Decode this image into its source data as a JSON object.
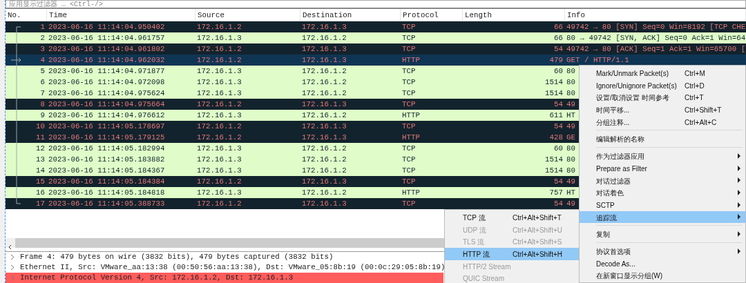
{
  "filter_bar": {
    "placeholder": "应用显示过滤器 … <Ctrl-/>"
  },
  "packet_list": {
    "columns": [
      "No.",
      "Time",
      "Source",
      "Destination",
      "Protocol",
      "Length",
      "Info"
    ],
    "rows": [
      {
        "no": "1",
        "time": "2023-06-16 11:14:04.950402",
        "source": "172.16.1.2",
        "destination": "172.16.1.3",
        "protocol": "TCP",
        "length": "66",
        "info": "49742 → 80 [SYN] Seq=0 Win=8192 [TCP CHE",
        "kind": "dark",
        "selected": false
      },
      {
        "no": "2",
        "time": "2023-06-16 11:14:04.961757",
        "source": "172.16.1.3",
        "destination": "172.16.1.2",
        "protocol": "TCP",
        "length": "66",
        "info": "80 → 49742 [SYN, ACK] Seq=0 Ack=1 Win=64",
        "kind": "light",
        "selected": false
      },
      {
        "no": "3",
        "time": "2023-06-16 11:14:04.961802",
        "source": "172.16.1.2",
        "destination": "172.16.1.3",
        "protocol": "TCP",
        "length": "54",
        "info": "49742 → 80 [ACK] Seq=1 Ack=1 Win=65700 [",
        "kind": "dark",
        "selected": false
      },
      {
        "no": "4",
        "time": "2023-06-16 11:14:04.962032",
        "source": "172.16.1.2",
        "destination": "172.16.1.3",
        "protocol": "HTTP",
        "length": "479",
        "info": "GET / HTTP/1.1",
        "kind": "dark",
        "selected": true
      },
      {
        "no": "5",
        "time": "2023-06-16 11:14:04.971877",
        "source": "172.16.1.3",
        "destination": "172.16.1.2",
        "protocol": "TCP",
        "length": "60",
        "info": "80",
        "kind": "light",
        "selected": false
      },
      {
        "no": "6",
        "time": "2023-06-16 11:14:04.972098",
        "source": "172.16.1.3",
        "destination": "172.16.1.2",
        "protocol": "TCP",
        "length": "1514",
        "info": "80",
        "kind": "light",
        "selected": false
      },
      {
        "no": "7",
        "time": "2023-06-16 11:14:04.975624",
        "source": "172.16.1.3",
        "destination": "172.16.1.2",
        "protocol": "TCP",
        "length": "1514",
        "info": "80",
        "kind": "light",
        "selected": false
      },
      {
        "no": "8",
        "time": "2023-06-16 11:14:04.975664",
        "source": "172.16.1.2",
        "destination": "172.16.1.3",
        "protocol": "TCP",
        "length": "54",
        "info": "49",
        "kind": "dark",
        "selected": false
      },
      {
        "no": "9",
        "time": "2023-06-16 11:14:04.976612",
        "source": "172.16.1.3",
        "destination": "172.16.1.2",
        "protocol": "HTTP",
        "length": "611",
        "info": "HT",
        "kind": "light",
        "selected": false
      },
      {
        "no": "10",
        "time": "2023-06-16 11:14:05.178697",
        "source": "172.16.1.2",
        "destination": "172.16.1.3",
        "protocol": "TCP",
        "length": "54",
        "info": "49",
        "kind": "dark",
        "selected": false
      },
      {
        "no": "11",
        "time": "2023-06-16 11:14:05.179125",
        "source": "172.16.1.2",
        "destination": "172.16.1.3",
        "protocol": "HTTP",
        "length": "428",
        "info": "GE",
        "kind": "dark",
        "selected": false
      },
      {
        "no": "12",
        "time": "2023-06-16 11:14:05.182994",
        "source": "172.16.1.3",
        "destination": "172.16.1.2",
        "protocol": "TCP",
        "length": "60",
        "info": "80",
        "kind": "light",
        "selected": false
      },
      {
        "no": "13",
        "time": "2023-06-16 11:14:05.183882",
        "source": "172.16.1.3",
        "destination": "172.16.1.2",
        "protocol": "TCP",
        "length": "1514",
        "info": "80",
        "kind": "light",
        "selected": false
      },
      {
        "no": "14",
        "time": "2023-06-16 11:14:05.184367",
        "source": "172.16.1.3",
        "destination": "172.16.1.2",
        "protocol": "TCP",
        "length": "1514",
        "info": "80",
        "kind": "light",
        "selected": false
      },
      {
        "no": "15",
        "time": "2023-06-16 11:14:05.184384",
        "source": "172.16.1.2",
        "destination": "172.16.1.3",
        "protocol": "TCP",
        "length": "54",
        "info": "49",
        "kind": "dark",
        "selected": false
      },
      {
        "no": "16",
        "time": "2023-06-16 11:14:05.184818",
        "source": "172.16.1.3",
        "destination": "172.16.1.2",
        "protocol": "HTTP",
        "length": "757",
        "info": "HT",
        "kind": "light",
        "selected": false
      },
      {
        "no": "17",
        "time": "2023-06-16 11:14:05.388733",
        "source": "172.16.1.2",
        "destination": "172.16.1.3",
        "protocol": "TCP",
        "length": "54",
        "info": "49",
        "kind": "dark",
        "selected": false
      }
    ]
  },
  "detail_tree": [
    {
      "label": "Frame 4: 479 bytes on wire (3832 bits), 479 bytes captured (3832 bits)",
      "expanded": false,
      "highlighted": false
    },
    {
      "label": "Ethernet II, Src: VMware_aa:13:38 (00:50:56:aa:13:38), Dst: VMware_05:8b:19 (00:0c:29:05:8b:19)",
      "expanded": false,
      "highlighted": false
    },
    {
      "label": "Internet Protocol Version 4, Src: 172.16.1.2, Dst: 172.16.1.3",
      "expanded": false,
      "highlighted": true
    }
  ],
  "context_menu": [
    {
      "kind": "item",
      "label": "Mark/Unmark Packet(s)",
      "shortcut": "Ctrl+M",
      "submenu": false,
      "highlighted": false
    },
    {
      "kind": "item",
      "label": "Ignore/Unignore Packet(s)",
      "shortcut": "Ctrl+D",
      "submenu": false,
      "highlighted": false
    },
    {
      "kind": "item",
      "label": "设置/取消设置 时间参考",
      "shortcut": "Ctrl+T",
      "submenu": false,
      "highlighted": false
    },
    {
      "kind": "item",
      "label": "时间平移...",
      "shortcut": "Ctrl+Shift+T",
      "submenu": false,
      "highlighted": false
    },
    {
      "kind": "item",
      "label": "分组注释...",
      "shortcut": "Ctrl+Alt+C",
      "submenu": false,
      "highlighted": false
    },
    {
      "kind": "separator"
    },
    {
      "kind": "item",
      "label": "编辑解析的名称",
      "submenu": false,
      "highlighted": false
    },
    {
      "kind": "separator"
    },
    {
      "kind": "item",
      "label": "作为过滤器应用",
      "submenu": true,
      "highlighted": false
    },
    {
      "kind": "item",
      "label": "Prepare as Filter",
      "submenu": true,
      "highlighted": false
    },
    {
      "kind": "item",
      "label": "对话过滤器",
      "submenu": true,
      "highlighted": false
    },
    {
      "kind": "item",
      "label": "对话着色",
      "submenu": true,
      "highlighted": false
    },
    {
      "kind": "item",
      "label": "SCTP",
      "submenu": true,
      "highlighted": false
    },
    {
      "kind": "item",
      "label": "追踪流",
      "submenu": true,
      "highlighted": true
    },
    {
      "kind": "separator"
    },
    {
      "kind": "item",
      "label": "复制",
      "submenu": true,
      "highlighted": false
    },
    {
      "kind": "separator"
    },
    {
      "kind": "item",
      "label": "协议首选项",
      "submenu": true,
      "highlighted": false
    },
    {
      "kind": "item",
      "label": "Decode As...",
      "submenu": false,
      "highlighted": false
    },
    {
      "kind": "item",
      "label": "在新窗口显示分组(W)",
      "submenu": false,
      "highlighted": false
    }
  ],
  "follow_submenu": [
    {
      "label": "TCP 流",
      "shortcut": "Ctrl+Alt+Shift+T",
      "disabled": false,
      "highlighted": false
    },
    {
      "label": "UDP 流",
      "shortcut": "Ctrl+Alt+Shift+U",
      "disabled": true,
      "highlighted": false
    },
    {
      "label": "TLS 流",
      "shortcut": "Ctrl+Alt+Shift+S",
      "disabled": true,
      "highlighted": false
    },
    {
      "label": "HTTP 流",
      "shortcut": "Ctrl+Alt+Shift+H",
      "disabled": false,
      "highlighted": true
    },
    {
      "label": "HTTP/2 Stream",
      "disabled": true,
      "highlighted": false
    },
    {
      "label": "QUIC Stream",
      "disabled": true,
      "highlighted": false
    }
  ]
}
